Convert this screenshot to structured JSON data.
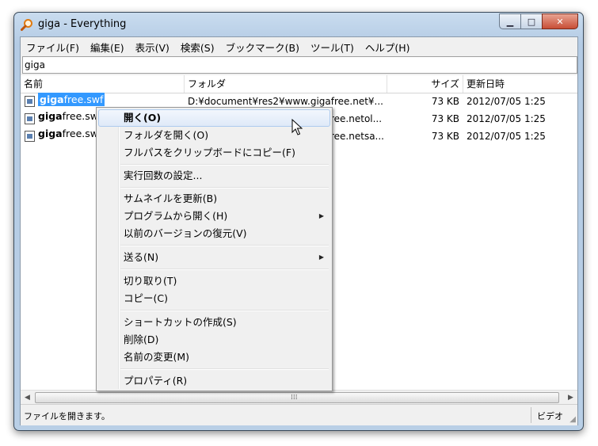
{
  "window": {
    "title": "giga - Everything"
  },
  "caption_buttons": {
    "min": "▁",
    "max": "□",
    "close": "✕"
  },
  "menubar": [
    "ファイル(F)",
    "編集(E)",
    "表示(V)",
    "検索(S)",
    "ブックマーク(B)",
    "ツール(T)",
    "ヘルプ(H)"
  ],
  "search": {
    "value": "giga"
  },
  "columns": {
    "name": "名前",
    "folder": "フォルダ",
    "size": "サイズ",
    "date": "更新日時"
  },
  "rows": [
    {
      "name_bold": "giga",
      "name_rest": "free.swf",
      "folder": "D:¥document¥res2¥www.gigafree.net¥...",
      "size": "73 KB",
      "date": "2012/07/05 1:25",
      "selected": true
    },
    {
      "name_bold": "giga",
      "name_rest": "free.swf",
      "folder": "ree.netol...",
      "size": "73 KB",
      "date": "2012/07/05 1:25",
      "selected": false
    },
    {
      "name_bold": "giga",
      "name_rest": "free.swf",
      "folder": "ree.netsa...",
      "size": "73 KB",
      "date": "2012/07/05 1:25",
      "selected": false
    }
  ],
  "context_menu": [
    {
      "label": "開く(O)",
      "highlight": true
    },
    {
      "label": "フォルダを開く(O)"
    },
    {
      "label": "フルパスをクリップボードにコピー(F)"
    },
    {
      "label": "実行回数の設定..."
    },
    {
      "label": "サムネイルを更新(B)"
    },
    {
      "label": "プログラムから開く(H)",
      "submenu": true
    },
    {
      "label": "以前のバージョンの復元(V)"
    },
    {
      "label": "送る(N)",
      "submenu": true
    },
    {
      "label": "切り取り(T)"
    },
    {
      "label": "コピー(C)"
    },
    {
      "label": "ショートカットの作成(S)"
    },
    {
      "label": "削除(D)"
    },
    {
      "label": "名前の変更(M)"
    },
    {
      "label": "プロパティ(R)"
    }
  ],
  "status": {
    "left": "ファイルを開きます。",
    "right": "ビデオ"
  },
  "colors": {
    "selection": "#3399ff",
    "menu_bg": "#f0f0f0",
    "close_button": "#c74e36"
  }
}
